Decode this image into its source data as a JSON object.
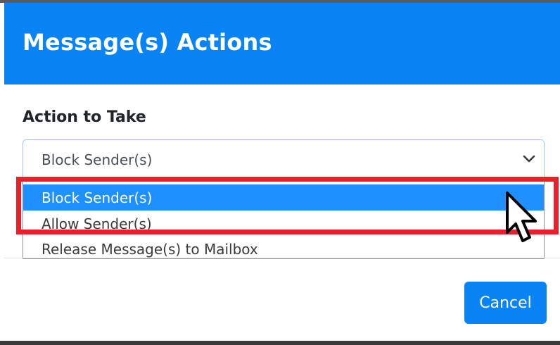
{
  "dialog": {
    "title": "Message(s) Actions",
    "header_color": "#0a84f5"
  },
  "action_field": {
    "label": "Action to Take",
    "selected_value": "Block Sender(s)",
    "options": [
      {
        "label": "Block Sender(s)",
        "highlighted": true
      },
      {
        "label": "Allow Sender(s)",
        "highlighted": false
      },
      {
        "label": "Release Message(s) to Mailbox",
        "highlighted": false
      }
    ]
  },
  "footer": {
    "cancel_label": "Cancel"
  },
  "annotation": {
    "highlight_color": "#e8202a"
  },
  "icons": {
    "dropdown": "chevron-down-icon",
    "pointer": "mouse-cursor-icon"
  }
}
